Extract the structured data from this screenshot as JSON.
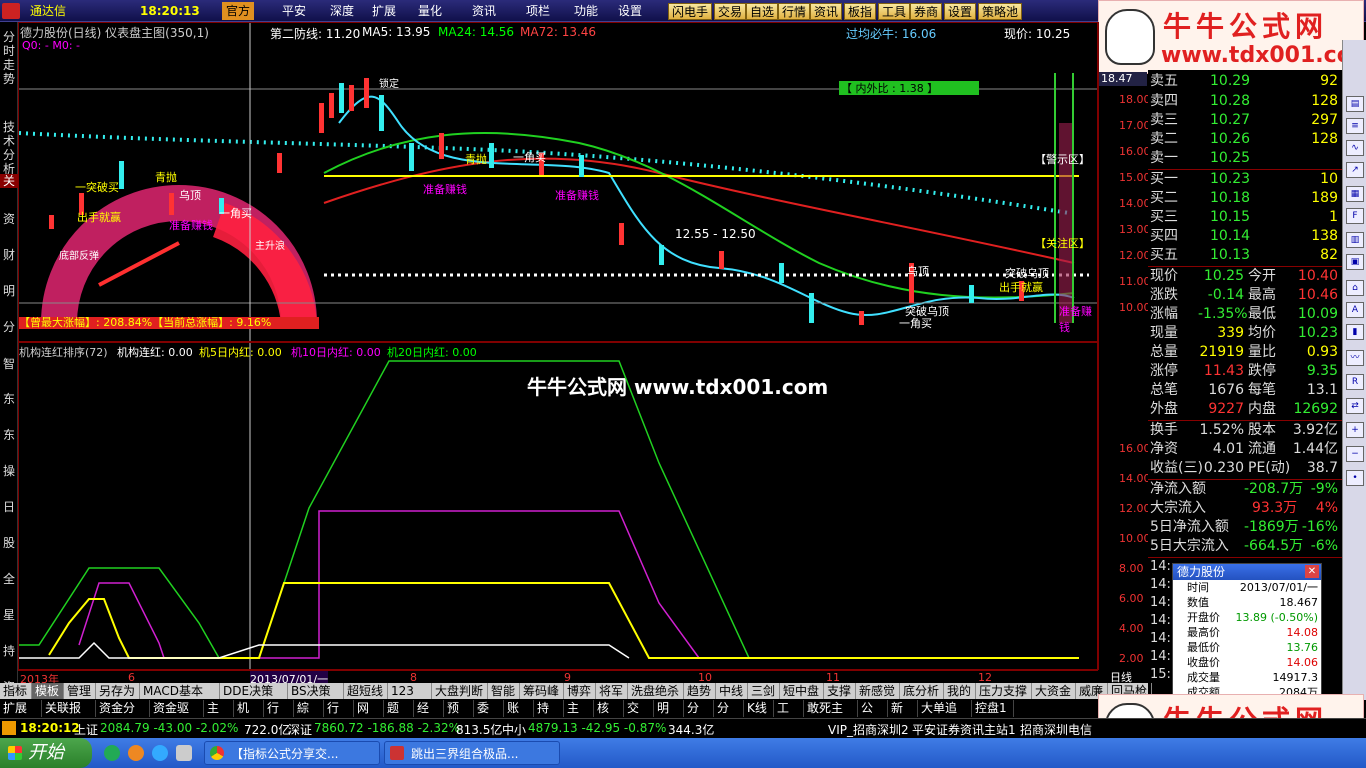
{
  "topbar": {
    "logo_text": "通达信",
    "time": "18:20:13",
    "menus": [
      "官方",
      "平安",
      "深度",
      "扩展",
      "量化",
      "资讯",
      "项栏",
      "功能",
      "设置"
    ],
    "buttons": [
      "闪电手",
      "交易",
      "自选",
      "行情",
      "资讯",
      "板指",
      "工具",
      "券商",
      "设置",
      "策略池"
    ]
  },
  "header": {
    "title": "德力股份(日线) 仪表盘主图(350,1)",
    "line2": "Q0: -    M0: -",
    "defense": "第二防线: 11.20",
    "ma5": "MA5: 13.95",
    "ma24": "MA24: 14.56",
    "ma72": "MA72: 13.46",
    "guojun": "过均必牛: 16.06",
    "price": "现价: 10.25"
  },
  "left_tabs": [
    "分时走势",
    "技术分析",
    "关",
    "资",
    "财",
    "明",
    "分",
    "智",
    "东",
    "东",
    "操",
    "日",
    "股",
    "全",
    "星",
    "持",
    "资"
  ],
  "main_labels": {
    "top_value": "18.47",
    "inner_outer": "【 内外比 : 1.38 】",
    "range": "12.55 - 12.50",
    "warn": "【警示区】",
    "focus": "【关注区】",
    "max_gain": "【曾最大涨幅】: 208.84%【当前总涨幅】: 9.16%",
    "signals": [
      "一突破买",
      "出手就赢",
      "青抛",
      "准备赚钱",
      "乌顶",
      "准备赚钱",
      "一角买",
      "锁定",
      "青抛",
      "一角买",
      "准备赚钱",
      "底部反弹",
      "主升浪",
      "乌顶",
      "突破乌顶",
      "一角买",
      "突破乌顶",
      "出手就赢",
      "准备赚钱"
    ]
  },
  "y_axis_main": [
    "18.00",
    "17.00",
    "16.00",
    "15.00",
    "14.00",
    "13.00",
    "12.00",
    "11.00",
    "10.00"
  ],
  "y_axis_sub": [
    "16.00",
    "14.00",
    "12.00",
    "10.00",
    "8.00",
    "6.00",
    "4.00",
    "2.00"
  ],
  "sub_header": {
    "name": "机构连红排序(72)",
    "lianhong": "机构连红: 0.00",
    "d5": "机5日内红: 0.00",
    "d10": "机10日内红: 0.00",
    "d20": "机20日内红: 0.00"
  },
  "watermark": "牛牛公式网 www.tdx001.com",
  "x_axis": {
    "labels": [
      "2013年",
      "6",
      "2013/07/01/一",
      "8",
      "9",
      "10",
      "11",
      "12"
    ],
    "period": "日线"
  },
  "quote": {
    "asks": [
      [
        "卖五",
        "10.29",
        "92"
      ],
      [
        "卖四",
        "10.28",
        "128"
      ],
      [
        "卖三",
        "10.27",
        "297"
      ],
      [
        "卖二",
        "10.26",
        "128"
      ],
      [
        "卖一",
        "10.25",
        ""
      ]
    ],
    "bids": [
      [
        "买一",
        "10.23",
        "10"
      ],
      [
        "买二",
        "10.18",
        "189"
      ],
      [
        "买三",
        "10.15",
        "1"
      ],
      [
        "买四",
        "10.14",
        "138"
      ],
      [
        "买五",
        "10.13",
        "82"
      ]
    ],
    "stats": [
      [
        "现价",
        "10.25",
        "今开",
        "10.40"
      ],
      [
        "涨跌",
        "-0.14",
        "最高",
        "10.46"
      ],
      [
        "涨幅",
        "-1.35%",
        "最低",
        "10.09"
      ],
      [
        "现量",
        "339",
        "均价",
        "10.23"
      ],
      [
        "总量",
        "21919",
        "量比",
        "0.93"
      ],
      [
        "涨停",
        "11.43",
        "跌停",
        "9.35"
      ],
      [
        "总笔",
        "1676",
        "每笔",
        "13.1"
      ],
      [
        "外盘",
        "9227",
        "内盘",
        "12692"
      ],
      [
        "换手",
        "1.52%",
        "股本",
        "3.92亿"
      ],
      [
        "净资",
        "4.01",
        "流通",
        "1.44亿"
      ],
      [
        "收益(三)",
        "0.230",
        "PE(动)",
        "38.7"
      ]
    ],
    "flows": [
      [
        "净流入额",
        "-208.7万",
        "-9%"
      ],
      [
        "大宗流入",
        "93.3万",
        "4%"
      ],
      [
        "5日净流入额",
        "-1869万",
        "-16%"
      ],
      [
        "5日大宗流入",
        "-664.5万",
        "-6%"
      ]
    ],
    "ticks": [
      "14:",
      "14:",
      "14:",
      "14:",
      "14:",
      "14:",
      "15:"
    ]
  },
  "popup": {
    "title": "德力股份",
    "rows": [
      [
        "时间",
        "2013/07/01/一"
      ],
      [
        "数值",
        "18.467"
      ],
      [
        "开盘价",
        "13.89 (-0.50%)"
      ],
      [
        "最高价",
        "14.08"
      ],
      [
        "最低价",
        "13.76"
      ],
      [
        "收盘价",
        "14.06"
      ],
      [
        "成交量",
        "14917.3"
      ],
      [
        "成交额",
        "2084万"
      ]
    ]
  },
  "bottom_tabs": [
    "指标",
    "模板",
    "管理",
    "另存为",
    "MACD基本",
    "DDE决策",
    "BS决策",
    "超短线",
    "123",
    "大盘判断",
    "智能",
    "筹码峰",
    "博弈",
    "将军",
    "洗盘绝杀",
    "趋势",
    "中线",
    "三剑",
    "短中盘",
    "支撑",
    "新感觉",
    "底分析",
    "我的",
    "压力支撑",
    "大资金",
    "威廉",
    "回马枪"
  ],
  "bottom_tabs2": [
    "扩展区",
    "关联报价",
    "资金分布",
    "资金驱动",
    "主力",
    "机构",
    "行业",
    "綜新",
    "行新",
    "网新",
    "题材",
    "经指",
    "预收",
    "委托",
    "账户",
    "持仓",
    "主题",
    "核题",
    "交异",
    "明细",
    "分价",
    "分时",
    "K线",
    "工具",
    "敢死主力",
    "公告",
    "新闻",
    "大单追踪",
    "控盘1"
  ],
  "status": {
    "time": "18:20:12",
    "sh": "上证",
    "sh_val": "2084.79 -43.00 -2.02%",
    "sh_amt": "722.0亿",
    "sz": "深证",
    "sz_val": "7860.72 -186.88 -2.32%",
    "sz_amt": "813.5亿",
    "zx": "中小",
    "zx_val": "4879.13 -42.95 -0.87%",
    "zx_amt": "344.3亿",
    "vip": "VIP_招商深圳2",
    "server": "平安证券资讯主站1",
    "server2": "招商深圳电信"
  },
  "taskbar": {
    "start": "开始",
    "tasks": [
      "【指标公式分享交...",
      "跳出三界组合极品..."
    ]
  },
  "logos": {
    "t1": "牛牛公式网",
    "t2": "www.tdx001.com"
  }
}
